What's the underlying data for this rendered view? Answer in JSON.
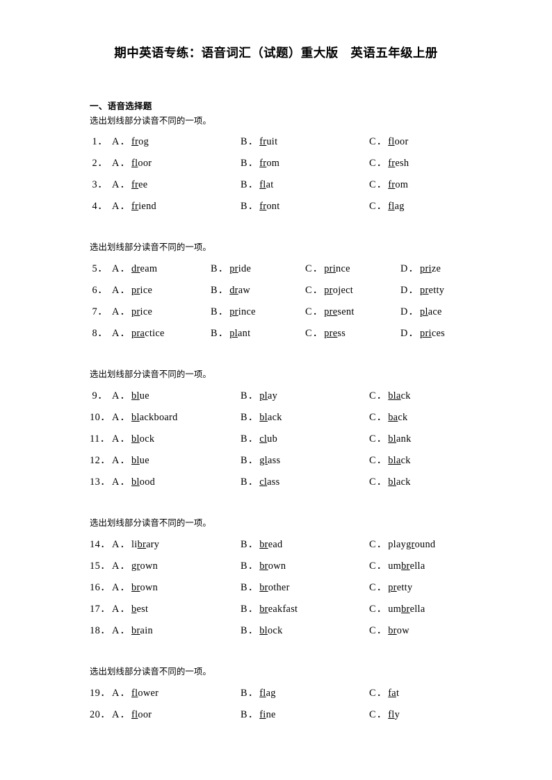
{
  "document": {
    "title": "期中英语专练：语音词汇（试题）重大版　英语五年级上册",
    "section_heading": "一、语音选择题",
    "instruction": "选出划线部分读音不同的一项。"
  },
  "groups": [
    {
      "instruction": "选出划线部分读音不同的一项。",
      "columns": 3,
      "option_labels": [
        "A．",
        "B．",
        "C．"
      ],
      "questions": [
        {
          "number": "1．",
          "options": [
            {
              "label": "A．",
              "underlined": "fr",
              "rest": "og",
              "word": "frog"
            },
            {
              "label": "B．",
              "underlined": "fr",
              "rest": "uit",
              "word": "fruit"
            },
            {
              "label": "C．",
              "underlined": "fl",
              "rest": "oor",
              "word": "floor"
            }
          ]
        },
        {
          "number": "2．",
          "options": [
            {
              "label": "A．",
              "underlined": "fl",
              "rest": "oor",
              "word": "floor"
            },
            {
              "label": "B．",
              "underlined": "fr",
              "rest": "om",
              "word": "from"
            },
            {
              "label": "C．",
              "underlined": "fr",
              "rest": "esh",
              "word": "fresh"
            }
          ]
        },
        {
          "number": "3．",
          "options": [
            {
              "label": "A．",
              "underlined": "fr",
              "rest": "ee",
              "word": "free"
            },
            {
              "label": "B．",
              "underlined": "fl",
              "rest": "at",
              "word": "flat"
            },
            {
              "label": "C．",
              "underlined": "fr",
              "rest": "om",
              "word": "from"
            }
          ]
        },
        {
          "number": "4．",
          "options": [
            {
              "label": "A．",
              "underlined": "fr",
              "rest": "iend",
              "word": "friend"
            },
            {
              "label": "B．",
              "underlined": "fr",
              "rest": "ont",
              "word": "front"
            },
            {
              "label": "C．",
              "underlined": "fl",
              "rest": "ag",
              "word": "flag"
            }
          ]
        }
      ]
    },
    {
      "instruction": "选出划线部分读音不同的一项。",
      "columns": 4,
      "option_labels": [
        "A．",
        "B．",
        "C．",
        "D．"
      ],
      "questions": [
        {
          "number": "5．",
          "options": [
            {
              "label": "A．",
              "underlined": "dr",
              "rest": "eam",
              "word": "dream"
            },
            {
              "label": "B．",
              "underlined": "pr",
              "rest": "ide",
              "word": "pride"
            },
            {
              "label": "C．",
              "underlined": "pri",
              "rest": "nce",
              "word": "prince"
            },
            {
              "label": "D．",
              "underlined": "pri",
              "rest": "ze",
              "word": "prize"
            }
          ]
        },
        {
          "number": "6．",
          "options": [
            {
              "label": "A．",
              "underlined": "pr",
              "rest": "ice",
              "word": "price"
            },
            {
              "label": "B．",
              "underlined": "dr",
              "rest": "aw",
              "word": "draw"
            },
            {
              "label": "C．",
              "underlined": "pr",
              "rest": "oject",
              "word": "project"
            },
            {
              "label": "D．",
              "underlined": "pr",
              "rest": "etty",
              "word": "pretty"
            }
          ]
        },
        {
          "number": "7．",
          "options": [
            {
              "label": "A．",
              "underlined": "pr",
              "rest": "ice",
              "word": "price"
            },
            {
              "label": "B．",
              "underlined": "pr",
              "rest": "ince",
              "word": "prince"
            },
            {
              "label": "C．",
              "underlined": "pre",
              "rest": "sent",
              "word": "present"
            },
            {
              "label": "D．",
              "underlined": "pl",
              "rest": "ace",
              "word": "place"
            }
          ]
        },
        {
          "number": "8．",
          "options": [
            {
              "label": "A．",
              "underlined": "pra",
              "rest": "ctice",
              "word": "practice"
            },
            {
              "label": "B．",
              "underlined": "pl",
              "rest": "ant",
              "word": "plant"
            },
            {
              "label": "C．",
              "underlined": "pre",
              "rest": "ss",
              "word": "press"
            },
            {
              "label": "D．",
              "underlined": "pri",
              "rest": "ces",
              "word": "prices"
            }
          ]
        }
      ]
    },
    {
      "instruction": "选出划线部分读音不同的一项。",
      "columns": 3,
      "option_labels": [
        "A．",
        "B．",
        "C．"
      ],
      "questions": [
        {
          "number": "9．",
          "options": [
            {
              "label": "A．",
              "underlined": "bl",
              "rest": "ue",
              "word": "blue"
            },
            {
              "label": "B．",
              "underlined": "pl",
              "rest": "ay",
              "word": "play"
            },
            {
              "label": "C．",
              "underlined": "bla",
              "rest": "ck",
              "word": "black"
            }
          ]
        },
        {
          "number": "10．",
          "options": [
            {
              "label": "A．",
              "underlined": "bl",
              "rest": "ackboard",
              "word": "blackboard"
            },
            {
              "label": "B．",
              "underlined": "bl",
              "rest": "ack",
              "word": "black"
            },
            {
              "label": "C．",
              "underlined": "ba",
              "rest": "ck",
              "word": "back"
            }
          ]
        },
        {
          "number": "11．",
          "options": [
            {
              "label": "A．",
              "underlined": "bl",
              "rest": "ock",
              "word": "block"
            },
            {
              "label": "B．",
              "underlined": "cl",
              "rest": "ub",
              "word": "club"
            },
            {
              "label": "C．",
              "underlined": "bl",
              "rest": "ank",
              "word": "blank"
            }
          ]
        },
        {
          "number": "12．",
          "options": [
            {
              "label": "A．",
              "underlined": "bl",
              "rest": "ue",
              "word": "blue"
            },
            {
              "label": "B．",
              "underlined": "gl",
              "rest": "ass",
              "word": "glass"
            },
            {
              "label": "C．",
              "underlined": "bla",
              "rest": "ck",
              "word": "black"
            }
          ]
        },
        {
          "number": "13．",
          "options": [
            {
              "label": "A．",
              "underlined": "bl",
              "rest": "ood",
              "word": "blood"
            },
            {
              "label": "B．",
              "underlined": "cl",
              "rest": "ass",
              "word": "class"
            },
            {
              "label": "C．",
              "underlined": "bl",
              "rest": "ack",
              "word": "black"
            }
          ]
        }
      ]
    },
    {
      "instruction": "选出划线部分读音不同的一项。",
      "columns": 3,
      "option_labels": [
        "A．",
        "B．",
        "C．"
      ],
      "questions": [
        {
          "number": "14．",
          "options": [
            {
              "label": "A．",
              "prefix": "li",
              "underlined": "br",
              "rest": "ary",
              "word": "library"
            },
            {
              "label": "B．",
              "underlined": "br",
              "rest": "ead",
              "word": "bread"
            },
            {
              "label": "C．",
              "prefix": "play",
              "underlined": "gr",
              "rest": "ound",
              "word": "playground"
            }
          ]
        },
        {
          "number": "15．",
          "options": [
            {
              "label": "A．",
              "underlined": "gr",
              "rest": "own",
              "word": "grown"
            },
            {
              "label": "B．",
              "underlined": "br",
              "rest": "own",
              "word": "brown"
            },
            {
              "label": "C．",
              "prefix": "um",
              "underlined": "br",
              "rest": "ella",
              "word": "umbrella"
            }
          ]
        },
        {
          "number": "16．",
          "options": [
            {
              "label": "A．",
              "underlined": "br",
              "rest": "own",
              "word": "brown"
            },
            {
              "label": "B．",
              "underlined": "br",
              "rest": "other",
              "word": "brother"
            },
            {
              "label": "C．",
              "underlined": "pr",
              "rest": "etty",
              "word": "pretty"
            }
          ]
        },
        {
          "number": "17．",
          "options": [
            {
              "label": "A．",
              "underlined": "b",
              "rest": "est",
              "word": "best"
            },
            {
              "label": "B．",
              "underlined": "br",
              "rest": "eakfast",
              "word": "breakfast"
            },
            {
              "label": "C．",
              "prefix": "um",
              "underlined": "br",
              "rest": "ella",
              "word": "umbrella"
            }
          ]
        },
        {
          "number": "18．",
          "options": [
            {
              "label": "A．",
              "underlined": "br",
              "rest": "ain",
              "word": "brain"
            },
            {
              "label": "B．",
              "underlined": "bl",
              "rest": "ock",
              "word": "block"
            },
            {
              "label": "C．",
              "underlined": "br",
              "rest": "ow",
              "word": "brow"
            }
          ]
        }
      ]
    },
    {
      "instruction": "选出划线部分读音不同的一项。",
      "columns": 3,
      "option_labels": [
        "A．",
        "B．",
        "C．"
      ],
      "questions": [
        {
          "number": "19．",
          "options": [
            {
              "label": "A．",
              "underlined": "fl",
              "rest": "ower",
              "word": "flower"
            },
            {
              "label": "B．",
              "underlined": "fl",
              "rest": "ag",
              "word": "flag"
            },
            {
              "label": "C．",
              "underlined": "fa",
              "rest": "t",
              "word": "fat"
            }
          ]
        },
        {
          "number": "20．",
          "options": [
            {
              "label": "A．",
              "underlined": "fl",
              "rest": "oor",
              "word": "floor"
            },
            {
              "label": "B．",
              "underlined": "fi",
              "rest": "ne",
              "word": "fine"
            },
            {
              "label": "C．",
              "underlined": "fl",
              "rest": "y",
              "word": "fly"
            }
          ]
        }
      ]
    }
  ]
}
